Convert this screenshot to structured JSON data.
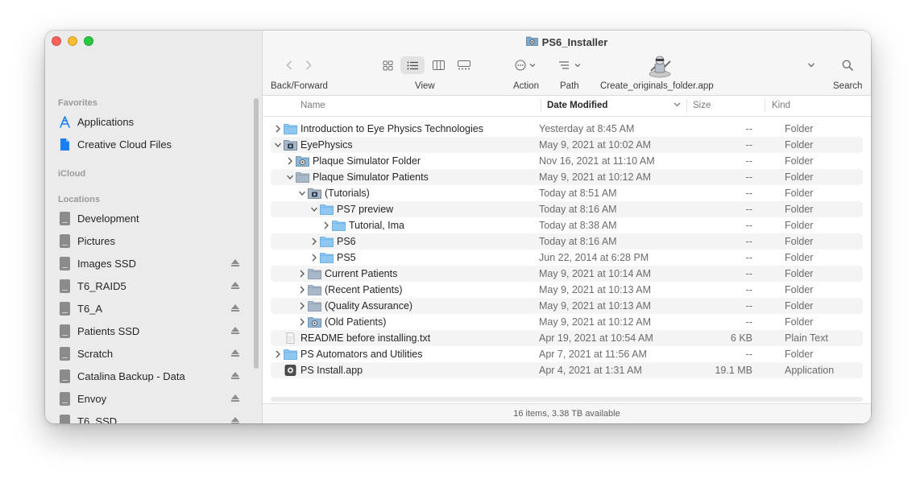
{
  "window": {
    "title": "PS6_Installer"
  },
  "toolbar": {
    "back_forward_label": "Back/Forward",
    "view_label": "View",
    "action_label": "Action",
    "path_label": "Path",
    "app_label": "Create_originals_folder.app",
    "search_label": "Search"
  },
  "sidebar": {
    "favorites_header": "Favorites",
    "favorites": [
      {
        "label": "Applications",
        "icon": "applications-icon"
      },
      {
        "label": "Creative Cloud Files",
        "icon": "document-icon"
      }
    ],
    "icloud_header": "iCloud",
    "locations_header": "Locations",
    "locations": [
      {
        "label": "Development",
        "eject": false
      },
      {
        "label": "Pictures",
        "eject": false
      },
      {
        "label": "Images SSD",
        "eject": true
      },
      {
        "label": "T6_RAID5",
        "eject": true
      },
      {
        "label": "T6_A",
        "eject": true
      },
      {
        "label": "Patients SSD",
        "eject": true
      },
      {
        "label": "Scratch",
        "eject": true
      },
      {
        "label": "Catalina Backup - Data",
        "eject": true
      },
      {
        "label": "Envoy",
        "eject": true
      },
      {
        "label": "T6_SSD",
        "eject": true
      }
    ]
  },
  "columns": {
    "name": "Name",
    "date": "Date Modified",
    "size": "Size",
    "kind": "Kind"
  },
  "rows": [
    {
      "name": "Introduction to Eye Physics Technologies",
      "date": "Yesterday at 8:45 AM",
      "size": "--",
      "kind": "Folder",
      "indent": 0,
      "disclosure": "closed",
      "icon": "folder"
    },
    {
      "name": "EyePhysics",
      "date": "May 9, 2021 at 10:02 AM",
      "size": "--",
      "kind": "Folder",
      "indent": 0,
      "disclosure": "open",
      "icon": "folder-dark"
    },
    {
      "name": "Plaque Simulator Folder",
      "date": "Nov 16, 2021 at 11:10 AM",
      "size": "--",
      "kind": "Folder",
      "indent": 1,
      "disclosure": "closed",
      "icon": "folder-badge"
    },
    {
      "name": "Plaque Simulator Patients",
      "date": "May 9, 2021 at 10:12 AM",
      "size": "--",
      "kind": "Folder",
      "indent": 1,
      "disclosure": "open",
      "icon": "folder-gray"
    },
    {
      "name": "(Tutorials)",
      "date": "Today at 8:51 AM",
      "size": "--",
      "kind": "Folder",
      "indent": 2,
      "disclosure": "open",
      "icon": "folder-dark"
    },
    {
      "name": "PS7 preview",
      "date": "Today at 8:16 AM",
      "size": "--",
      "kind": "Folder",
      "indent": 3,
      "disclosure": "open",
      "icon": "folder"
    },
    {
      "name": "Tutorial, Ima",
      "date": "Today at 8:38 AM",
      "size": "--",
      "kind": "Folder",
      "indent": 4,
      "disclosure": "closed",
      "icon": "folder"
    },
    {
      "name": "PS6",
      "date": "Today at 8:16 AM",
      "size": "--",
      "kind": "Folder",
      "indent": 3,
      "disclosure": "closed",
      "icon": "folder"
    },
    {
      "name": "PS5",
      "date": "Jun 22, 2014 at 6:28 PM",
      "size": "--",
      "kind": "Folder",
      "indent": 3,
      "disclosure": "closed",
      "icon": "folder"
    },
    {
      "name": "Current Patients",
      "date": "May 9, 2021 at 10:14 AM",
      "size": "--",
      "kind": "Folder",
      "indent": 2,
      "disclosure": "closed",
      "icon": "folder-gray"
    },
    {
      "name": "(Recent Patients)",
      "date": "May 9, 2021 at 10:13 AM",
      "size": "--",
      "kind": "Folder",
      "indent": 2,
      "disclosure": "closed",
      "icon": "folder-gray"
    },
    {
      "name": "(Quality Assurance)",
      "date": "May 9, 2021 at 10:13 AM",
      "size": "--",
      "kind": "Folder",
      "indent": 2,
      "disclosure": "closed",
      "icon": "folder-gray"
    },
    {
      "name": "(Old Patients)",
      "date": "May 9, 2021 at 10:12 AM",
      "size": "--",
      "kind": "Folder",
      "indent": 2,
      "disclosure": "closed",
      "icon": "folder-badge"
    },
    {
      "name": "README before installing.txt",
      "date": "Apr 19, 2021 at 10:54 AM",
      "size": "6 KB",
      "kind": "Plain Text",
      "indent": 0,
      "disclosure": "none",
      "icon": "text-file"
    },
    {
      "name": "PS Automators and Utilities",
      "date": "Apr 7, 2021 at 11:56 AM",
      "size": "--",
      "kind": "Folder",
      "indent": 0,
      "disclosure": "closed",
      "icon": "folder"
    },
    {
      "name": "PS Install.app",
      "date": "Apr 4, 2021 at 1:31 AM",
      "size": "19.1 MB",
      "kind": "Application",
      "indent": 0,
      "disclosure": "none",
      "icon": "app"
    }
  ],
  "status": {
    "text": "16 items, 3.38 TB available"
  },
  "colors": {
    "accent": "#1f7cf6",
    "folder": "#8ec7f2",
    "folder_dark": "#5a7590"
  }
}
